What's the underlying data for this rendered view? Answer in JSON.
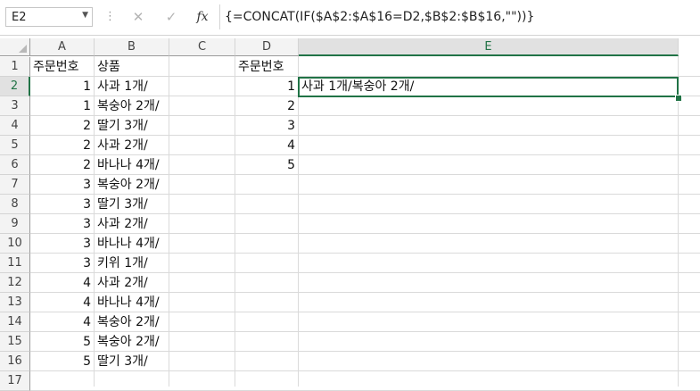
{
  "formula_bar": {
    "name_box": "E2",
    "cancel_icon": "✕",
    "enter_icon": "✓",
    "fx_label": "fx",
    "formula": "{=CONCAT(IF($A$2:$A$16=D2,$B$2:$B$16,\"\"))}"
  },
  "columns": [
    "A",
    "B",
    "C",
    "D",
    "E"
  ],
  "rows": [
    "1",
    "2",
    "3",
    "4",
    "5",
    "6",
    "7",
    "8",
    "9",
    "10",
    "11",
    "12",
    "13",
    "14",
    "15",
    "16",
    "17"
  ],
  "cells": {
    "A": [
      "주문번호",
      "1",
      "1",
      "2",
      "2",
      "2",
      "3",
      "3",
      "3",
      "3",
      "3",
      "4",
      "4",
      "4",
      "5",
      "5",
      ""
    ],
    "B": [
      "상품",
      "사과 1개/",
      "복숭아 2개/",
      "딸기 3개/",
      "사과 2개/",
      "바나나 4개/",
      "복숭아 2개/",
      "딸기 3개/",
      "사과 2개/",
      "바나나 4개/",
      "키위 1개/",
      "사과 2개/",
      "바나나 4개/",
      "복숭아 2개/",
      "복숭아 2개/",
      "딸기 3개/",
      ""
    ],
    "D": [
      "주문번호",
      "1",
      "2",
      "3",
      "4",
      "5",
      "",
      "",
      "",
      "",
      "",
      "",
      "",
      "",
      "",
      "",
      ""
    ],
    "E": [
      "",
      "사과 1개/복숭아 2개/",
      "",
      "",
      "",
      "",
      "",
      "",
      "",
      "",
      "",
      "",
      "",
      "",
      "",
      "",
      ""
    ]
  },
  "active_cell": "E2",
  "accent_color": "#217346"
}
